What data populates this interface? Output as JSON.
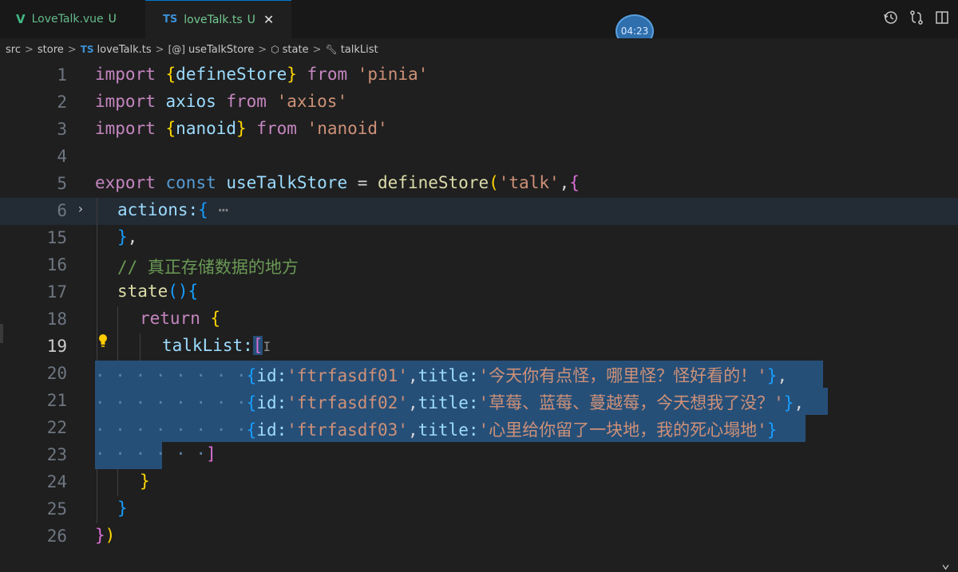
{
  "tabs": [
    {
      "icon": "V",
      "name": "LoveTalk.vue",
      "status": "U"
    },
    {
      "icon": "TS",
      "name": "loveTalk.ts",
      "status": "U",
      "close": "✕"
    }
  ],
  "timer": "04:23",
  "breadcrumb": {
    "src": "src",
    "store": "store",
    "ts_icon": "TS",
    "file": "loveTalk.ts",
    "var_icon": "[@]",
    "var": "useTalkStore",
    "state": "state",
    "talkList": "talkList"
  },
  "lines": {
    "n1": "1",
    "n2": "2",
    "n3": "3",
    "n4": "4",
    "n5": "5",
    "n6": "6",
    "n15": "15",
    "n16": "16",
    "n17": "17",
    "n18": "18",
    "n19": "19",
    "n20": "20",
    "n21": "21",
    "n22": "22",
    "n23": "23",
    "n24": "24",
    "n25": "25",
    "n26": "26"
  },
  "code": {
    "l1_import": "import ",
    "l1_lb": "{",
    "l1_name": "defineStore",
    "l1_rb": "}",
    "l1_from": " from ",
    "l1_str": "'pinia'",
    "l2_import": "import ",
    "l2_name": "axios",
    "l2_from": " from ",
    "l2_str": "'axios'",
    "l3_import": "import ",
    "l3_lb": "{",
    "l3_name": "nanoid",
    "l3_rb": "}",
    "l3_from": " from ",
    "l3_str": "'nanoid'",
    "l5_export": "export ",
    "l5_const": "const ",
    "l5_var": "useTalkStore",
    "l5_eq": " = ",
    "l5_fn": "defineStore",
    "l5_lp": "(",
    "l5_str": "'talk'",
    "l5_comma": ",",
    "l5_lb": "{",
    "l6_key": "actions:",
    "l6_lb": "{",
    "l6_dots": " ⋯",
    "l15_rb": "}",
    "l15_comma": ",",
    "l16_comment": "// 真正存储数据的地方",
    "l17_fn": "state",
    "l17_parens": "()",
    "l17_lb": "{",
    "l18_return": "return ",
    "l18_lb": "{",
    "l19_key": "talkList:",
    "l19_lb": "[",
    "l19_cursor": "I",
    "l20_dots": "· · · · · · · ·",
    "l20_lb": "{",
    "l20_id": "id:",
    "l20_idval": "'ftrfasdf01'",
    "l20_comma": ",",
    "l20_title": "title:",
    "l20_tval": "'今天你有点怪，哪里怪？怪好看的！'",
    "l20_rb": "}",
    "l20_end": ",",
    "l21_dots": "· · · · · · · ·",
    "l21_lb": "{",
    "l21_id": "id:",
    "l21_idval": "'ftrfasdf02'",
    "l21_comma": ",",
    "l21_title": "title:",
    "l21_tval": "'草莓、蓝莓、蔓越莓，今天想我了没？'",
    "l21_rb": "}",
    "l21_end": ",",
    "l22_dots": "· · · · · · · ·",
    "l22_lb": "{",
    "l22_id": "id:",
    "l22_idval": "'ftrfasdf03'",
    "l22_comma": ",",
    "l22_title": "title:",
    "l22_tval": "'心里给你留了一块地，我的死心塌地'",
    "l22_rb": "}",
    "l23_dots": "· · · · · ·",
    "l23_rb": "]",
    "l24_rb": "}",
    "l25_rb": "}",
    "l26_rb": "}",
    "l26_rp": ")"
  }
}
